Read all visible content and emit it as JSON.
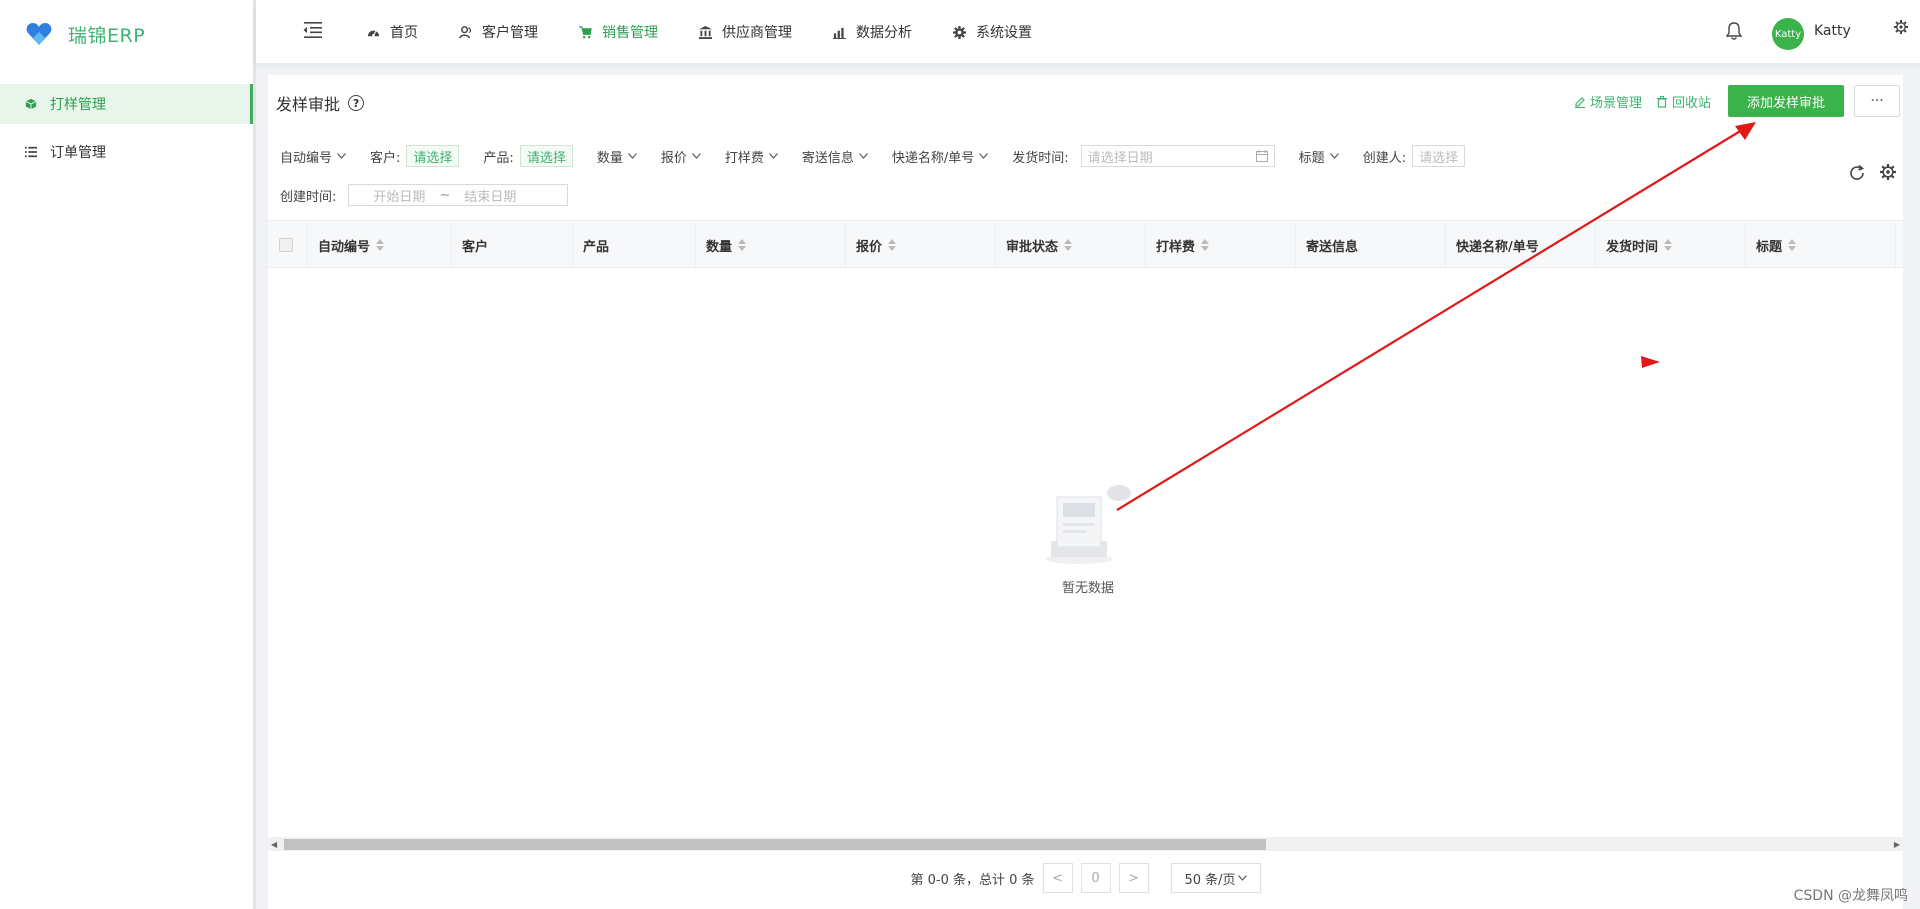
{
  "app": {
    "name": "瑞锦ERP"
  },
  "sidebar": {
    "items": [
      {
        "label": "打样管理",
        "icon": "cube-icon",
        "active": true
      },
      {
        "label": "订单管理",
        "icon": "list-icon",
        "active": false
      }
    ]
  },
  "topnav": {
    "items": [
      {
        "label": "首页",
        "icon": "dashboard-icon"
      },
      {
        "label": "客户管理",
        "icon": "user-group-icon"
      },
      {
        "label": "销售管理",
        "icon": "cart-icon",
        "active": true
      },
      {
        "label": "供应商管理",
        "icon": "bank-icon"
      },
      {
        "label": "数据分析",
        "icon": "bar-chart-icon"
      },
      {
        "label": "系统设置",
        "icon": "gear-icon"
      }
    ],
    "user": {
      "avatar_text": "Katty",
      "name": "Katty"
    }
  },
  "page": {
    "title": "发样审批",
    "scene_label": "场景管理",
    "recycle_label": "回收站",
    "add_label": "添加发样审批",
    "more_label": "···"
  },
  "filters": {
    "auto_no": "自动编号",
    "customer": "客户:",
    "customer_pick": "请选择",
    "product": "产品:",
    "product_pick": "请选择",
    "quantity": "数量",
    "quote": "报价",
    "sample_fee": "打样费",
    "shipping": "寄送信息",
    "express": "快递名称/单号",
    "ship_time": "发货时间:",
    "ship_time_placeholder": "请选择日期",
    "title": "标题",
    "creator": "创建人:",
    "creator_pick": "请选择",
    "create_time": "创建时间:",
    "start_date": "开始日期",
    "tilde": "~",
    "end_date": "结束日期"
  },
  "table": {
    "columns": [
      {
        "label": "自动编号",
        "sortable": true
      },
      {
        "label": "客户",
        "sortable": false
      },
      {
        "label": "产品",
        "sortable": false
      },
      {
        "label": "数量",
        "sortable": true
      },
      {
        "label": "报价",
        "sortable": true
      },
      {
        "label": "审批状态",
        "sortable": true
      },
      {
        "label": "打样费",
        "sortable": true
      },
      {
        "label": "寄送信息",
        "sortable": false
      },
      {
        "label": "快递名称/单号",
        "sortable": false
      },
      {
        "label": "发货时间",
        "sortable": true
      },
      {
        "label": "标题",
        "sortable": true
      }
    ],
    "rows": [],
    "empty_text": "暂无数据"
  },
  "pager": {
    "summary": "第 0-0 条，总计 0 条",
    "prev": "<",
    "current": "0",
    "next": ">",
    "page_size": "50 条/页"
  },
  "watermark": "CSDN @龙舞凤鸣",
  "colors": {
    "accent": "#3ab34a",
    "annotation": "#e01818"
  }
}
